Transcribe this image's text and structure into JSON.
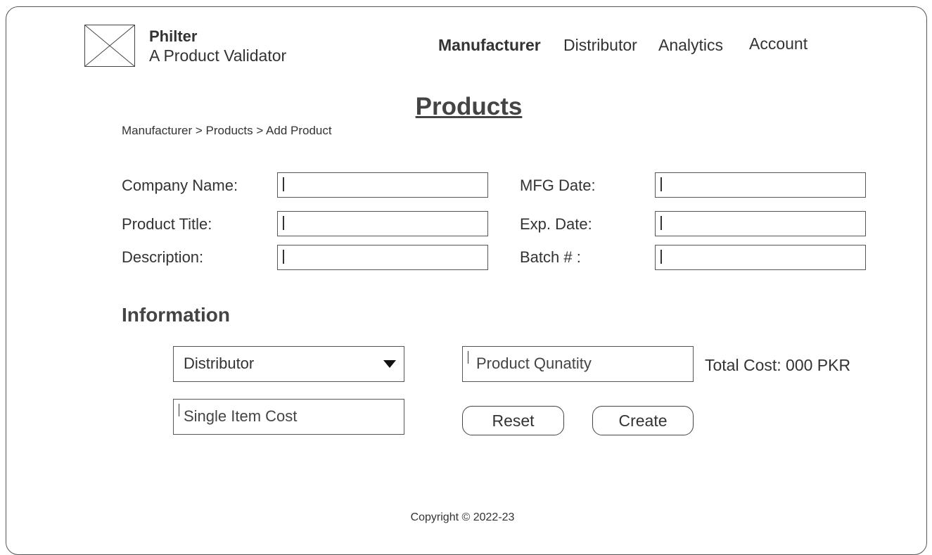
{
  "brand": {
    "name": "Philter",
    "tagline": "A Product Validator",
    "logo_icon": "image-placeholder-icon"
  },
  "nav": {
    "items": [
      {
        "label": "Manufacturer",
        "active": true
      },
      {
        "label": "Distributor",
        "active": false
      },
      {
        "label": "Analytics",
        "active": false
      },
      {
        "label": "Account",
        "active": false
      }
    ]
  },
  "page": {
    "title": "Products",
    "breadcrumb": "Manufacturer > Products > Add Product"
  },
  "form": {
    "company_name_label": "Company Name:",
    "product_title_label": "Product Title:",
    "description_label": "Description:",
    "mfg_date_label": "MFG Date:",
    "exp_date_label": "Exp. Date:",
    "batch_label": "Batch # :"
  },
  "information": {
    "heading": "Information",
    "distributor_select": {
      "selected": "Distributor"
    },
    "quantity_placeholder": "Product Qunatity",
    "single_cost_placeholder": "Single Item Cost",
    "total_cost_text": "Total Cost: 000 PKR",
    "reset_label": "Reset",
    "create_label": "Create"
  },
  "footer": {
    "copyright": "Copyright © 2022-23"
  }
}
